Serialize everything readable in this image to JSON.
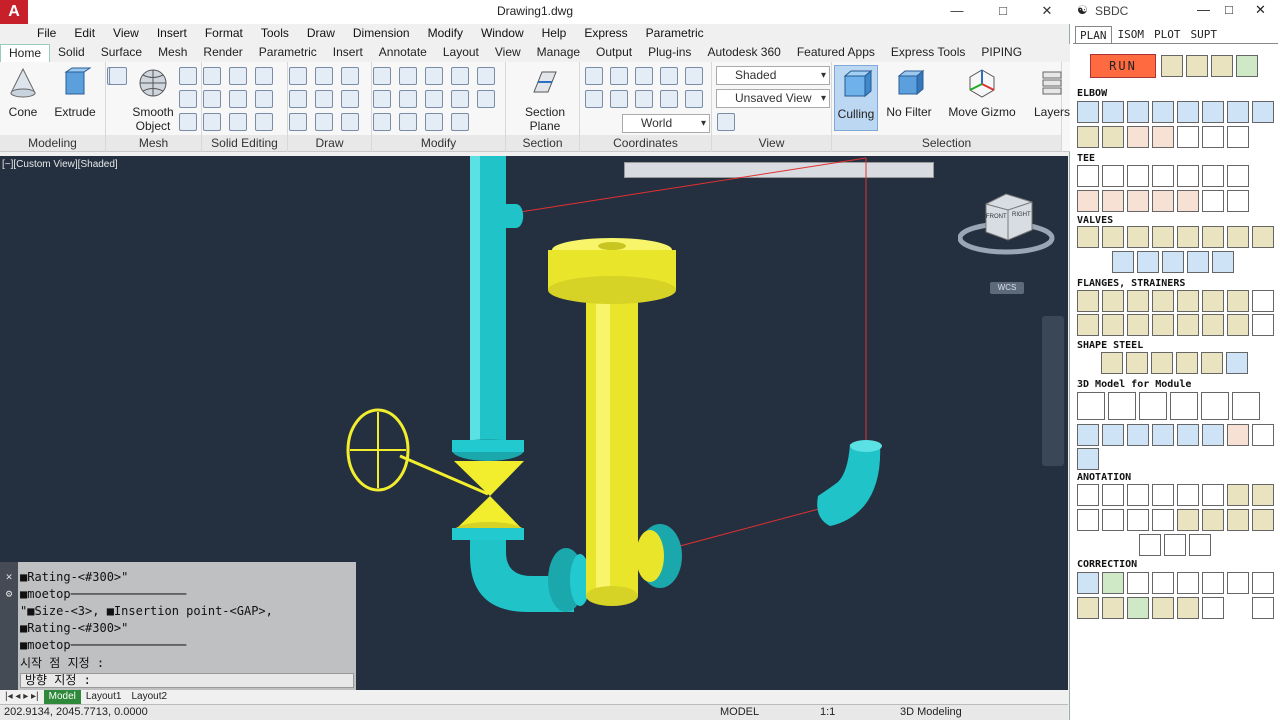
{
  "app": {
    "title": "Drawing1.dwg",
    "logo": "A",
    "menu": [
      "File",
      "Edit",
      "View",
      "Insert",
      "Format",
      "Tools",
      "Draw",
      "Dimension",
      "Modify",
      "Window",
      "Help",
      "Express",
      "Parametric"
    ],
    "tabs": [
      "Home",
      "Solid",
      "Surface",
      "Mesh",
      "Render",
      "Parametric",
      "Insert",
      "Annotate",
      "Layout",
      "View",
      "Manage",
      "Output",
      "Plug-ins",
      "Autodesk 360",
      "Featured Apps",
      "Express Tools",
      "PIPING"
    ],
    "active_tab": "Home"
  },
  "ribbon": {
    "panels": [
      "Modeling",
      "Mesh",
      "Solid Editing",
      "Draw",
      "Modify",
      "Section",
      "Coordinates",
      "View",
      "Selection"
    ],
    "buttons": {
      "cone": "Cone",
      "extrude": "Extrude",
      "smooth_object": "Smooth Object",
      "section_plane": "Section Plane",
      "culling": "Culling",
      "no_filter": "No Filter",
      "move_gizmo": "Move Gizmo",
      "layers": "Layers"
    },
    "combos": {
      "visual_style": "Shaded",
      "view": "Unsaved View",
      "ucs": "World"
    }
  },
  "viewport": {
    "label": "[−][Custom View][Shaded]",
    "viewcube_front": "FRONT",
    "viewcube_right": "RIGHT",
    "wcs": "WCS"
  },
  "command_line": {
    "lines": [
      "■Rating-<#300>\"",
      "■moetop────────────────",
      "\"■Size-<3>, ■Insertion point-<GAP>,",
      "■Rating-<#300>\"",
      "■moetop────────────────",
      "시작 점 지정 :"
    ],
    "prompt": "방향 지정 :"
  },
  "layout_tabs": [
    "Model",
    "Layout1",
    "Layout2"
  ],
  "status": {
    "coords": "202.9134, 2045.7713, 0.0000",
    "model": "MODEL",
    "scale": "1:1",
    "workspace": "3D Modeling"
  },
  "sbdc": {
    "title": "SBDC",
    "tabs": [
      "PLAN",
      "ISOM",
      "PLOT",
      "SUPT"
    ],
    "active_tab": "PLAN",
    "run": "RUN",
    "sections": [
      "ELBOW",
      "TEE",
      "VALVES",
      "FLANGES, STRAINERS",
      "SHAPE STEEL",
      "3D Model for Module",
      "ANOTATION",
      "CORRECTION"
    ]
  },
  "colors": {
    "pipe_cyan": "#1fc3c8",
    "pipe_yellow": "#f2ee2e",
    "viewport_bg": "#243040",
    "run_button": "#ff6a40"
  }
}
